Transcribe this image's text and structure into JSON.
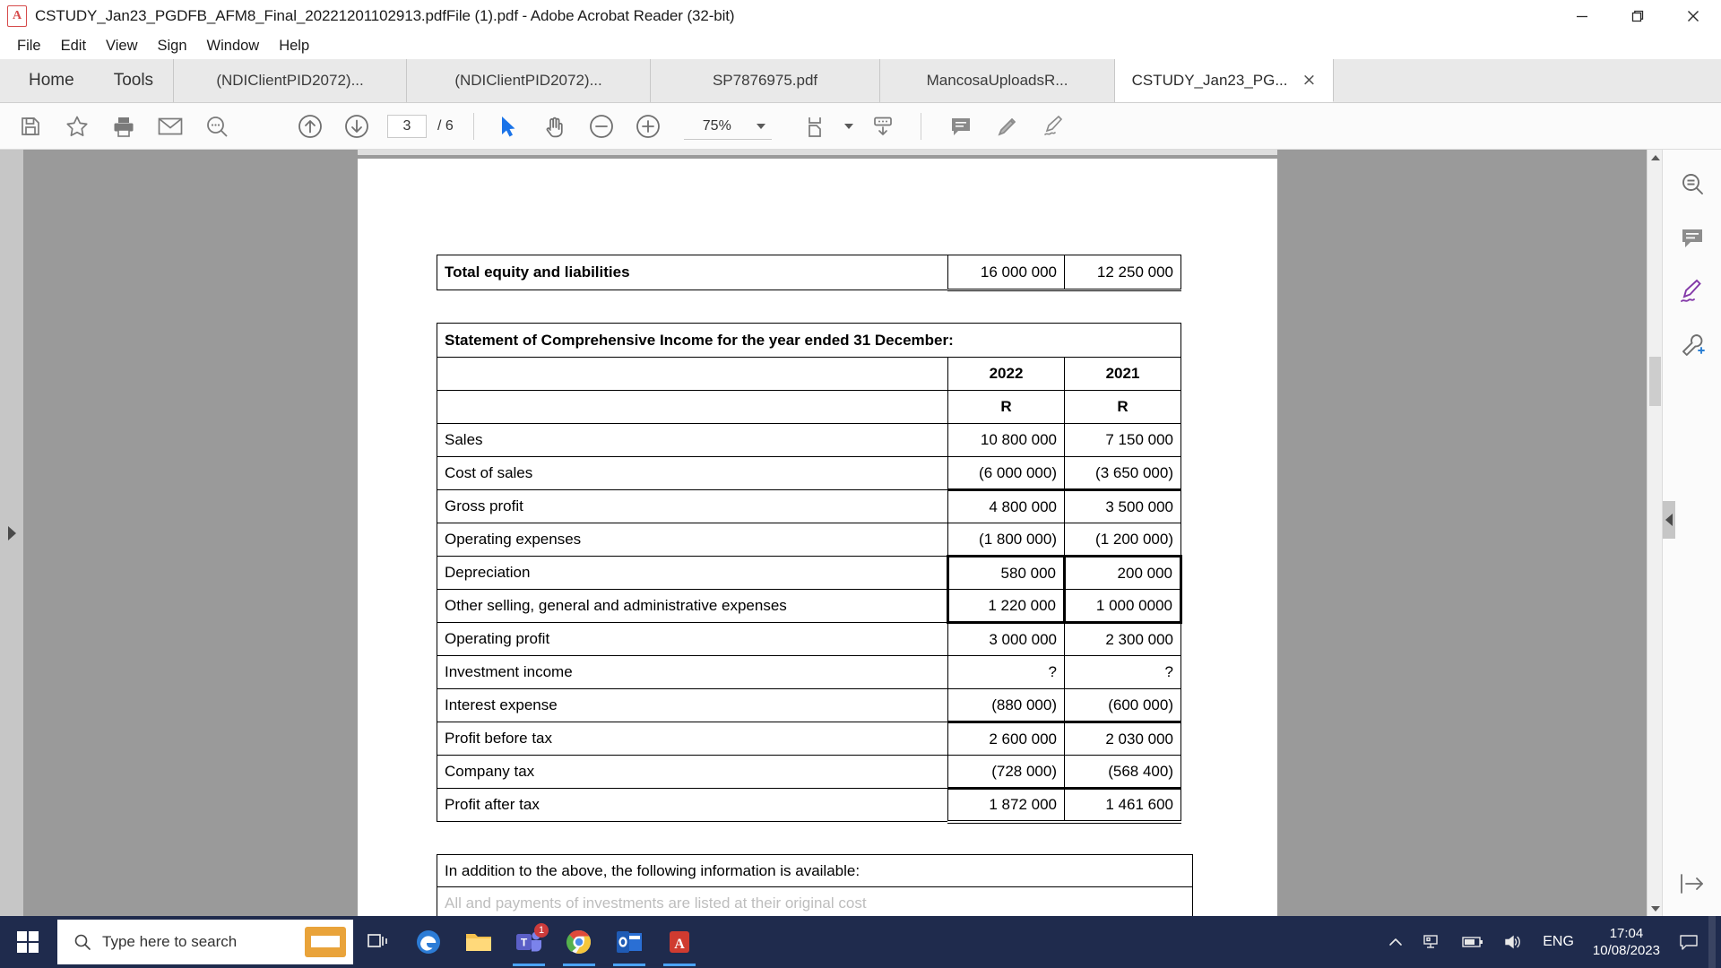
{
  "window": {
    "title": "CSTUDY_Jan23_PGDFB_AFM8_Final_20221201102913.pdfFile (1).pdf - Adobe Acrobat Reader (32-bit)",
    "app_icon": "acrobat-icon",
    "minimize_label": "Minimize",
    "restore_label": "Restore",
    "close_label": "Close"
  },
  "menubar": {
    "items": [
      {
        "label": "File"
      },
      {
        "label": "Edit"
      },
      {
        "label": "View"
      },
      {
        "label": "Sign"
      },
      {
        "label": "Window"
      },
      {
        "label": "Help"
      }
    ]
  },
  "dock": {
    "home_label": "Home",
    "tools_label": "Tools"
  },
  "tabs": [
    {
      "label": "(NDIClientPID2072)...",
      "active": false
    },
    {
      "label": "(NDIClientPID2072)...",
      "active": false
    },
    {
      "label": "SP7876975.pdf",
      "active": false
    },
    {
      "label": "MancosaUploadsR...",
      "active": false
    },
    {
      "label": "CSTUDY_Jan23_PG...",
      "active": true,
      "close_label": "×"
    }
  ],
  "toolbar": {
    "save_label": "Save",
    "star_label": "Add to favourites",
    "print_label": "Print",
    "email_label": "Email",
    "find_label": "Find",
    "prev_page_label": "Previous page",
    "next_page_label": "Next page",
    "page_number": "3",
    "page_total": "/ 6",
    "select_label": "Select tool",
    "hand_label": "Hand tool",
    "zoom_out_label": "Zoom out",
    "zoom_in_label": "Zoom in",
    "zoom_value": "75%",
    "fit_label": "Fit page",
    "scroll_mode_label": "Page scroll mode",
    "comment_label": "Add comment",
    "highlight_label": "Highlight text",
    "sign_label": "Fill and sign"
  },
  "right_rail": {
    "items": [
      {
        "name": "search-tool",
        "label": "Search"
      },
      {
        "name": "comment-tool",
        "label": "Comment"
      },
      {
        "name": "fill-sign-tool",
        "label": "Fill and Sign"
      },
      {
        "name": "more-tools",
        "label": "More tools"
      }
    ],
    "expand_label": "Expand pane"
  },
  "document": {
    "tables": {
      "total_row": {
        "label": "Total equity and liabilities",
        "y2022": "16 000 000",
        "y2021": "12 250 000"
      },
      "income_statement": {
        "title": "Statement of Comprehensive Income for the year ended 31 December:",
        "col_headers": [
          "",
          "2022",
          "2021"
        ],
        "currency_row": [
          "",
          "R",
          "R"
        ],
        "rows": [
          {
            "label": "Sales",
            "y2022": "10 800 000",
            "y2021": "7 150 000"
          },
          {
            "label": "Cost of sales",
            "y2022": "(6 000 000)",
            "y2021": "(3 650 000)"
          },
          {
            "label": "Gross profit",
            "y2022": "4 800 000",
            "y2021": "3 500 000"
          },
          {
            "label": "Operating expenses",
            "y2022": "(1 800 000)",
            "y2021": "(1 200 000)"
          },
          {
            "label": "Depreciation",
            "y2022": "580 000",
            "y2021": "200 000"
          },
          {
            "label": "Other selling, general and administrative expenses",
            "y2022": "1 220 000",
            "y2021": "1 000 0000"
          },
          {
            "label": "Operating profit",
            "y2022": "3 000 000",
            "y2021": "2 300 000"
          },
          {
            "label": "Investment income",
            "y2022": "?",
            "y2021": "?"
          },
          {
            "label": "Interest expense",
            "y2022": "(880 000)",
            "y2021": "(600 000)"
          },
          {
            "label": "Profit before tax",
            "y2022": "2 600 000",
            "y2021": "2 030 000"
          },
          {
            "label": "Company tax",
            "y2022": "(728 000)",
            "y2021": "(568 400)"
          },
          {
            "label": "Profit after tax",
            "y2022": "1 872 000",
            "y2021": "1 461 600"
          }
        ]
      },
      "note": {
        "line1": "In addition to the above, the following information is available:",
        "line2": "All and payments of investments are listed at their original cost"
      }
    }
  },
  "taskbar": {
    "start_label": "Start",
    "search_placeholder": "Type here to search",
    "apps": [
      {
        "name": "task-view",
        "label": "Task View"
      },
      {
        "name": "edge",
        "label": "Microsoft Edge"
      },
      {
        "name": "file-explorer",
        "label": "File Explorer"
      },
      {
        "name": "teams",
        "label": "Microsoft Teams",
        "badge": "1"
      },
      {
        "name": "chrome",
        "label": "Google Chrome"
      },
      {
        "name": "outlook",
        "label": "Microsoft Outlook"
      },
      {
        "name": "acrobat",
        "label": "Adobe Acrobat Reader"
      }
    ],
    "tray": {
      "show_hidden_label": "Show hidden icons",
      "network_label": "Network",
      "battery_label": "Battery",
      "volume_label": "Volume",
      "language": "ENG",
      "time": "17:04",
      "date": "10/08/2023",
      "action_center_label": "Action Center"
    }
  },
  "colors": {
    "taskbar_bg": "#1f2b4d",
    "doc_bg": "#9a9a9a",
    "tab_active": "#ffffff",
    "tab_inactive": "#e9e9e9",
    "accent_blue": "#1a73e8"
  }
}
